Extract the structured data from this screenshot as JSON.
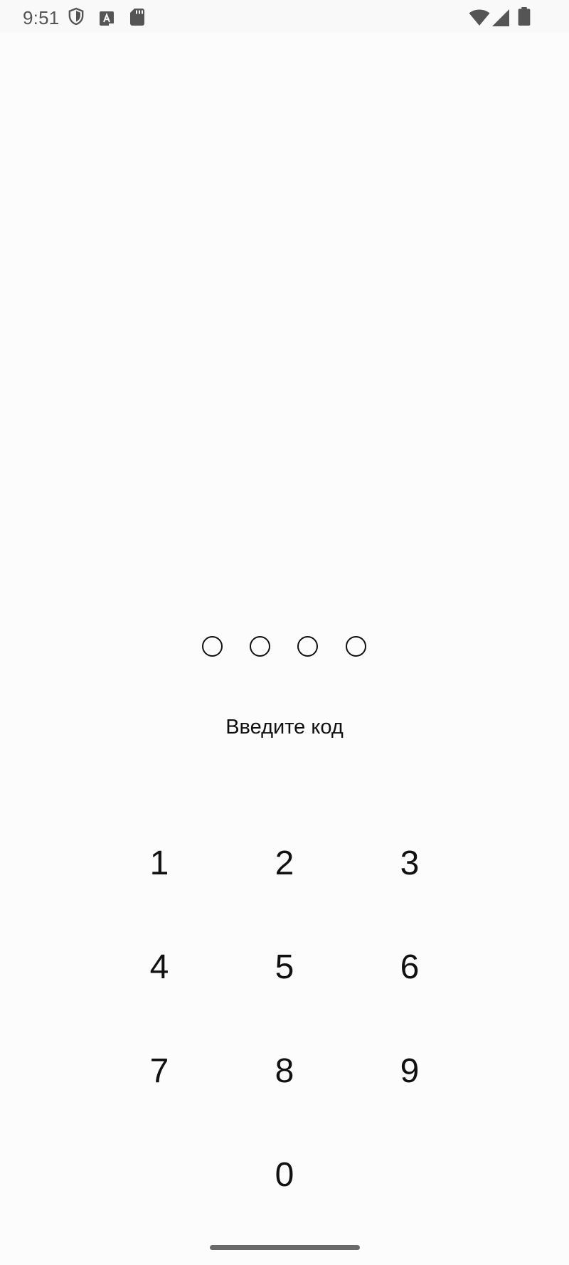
{
  "status_bar": {
    "time": "9:51",
    "icons": [
      "shield-icon",
      "text-a-box-icon",
      "sd-card-icon",
      "wifi-icon",
      "cell-signal-icon",
      "battery-icon"
    ]
  },
  "pin": {
    "length": 4,
    "entered": 0
  },
  "prompt": "Введите код",
  "keypad": {
    "keys": [
      "1",
      "2",
      "3",
      "4",
      "5",
      "6",
      "7",
      "8",
      "9",
      "0"
    ]
  },
  "colors": {
    "background": "#fcfcfc",
    "text": "#111111",
    "status_text": "#555555",
    "home_indicator": "#6a6a6a"
  }
}
